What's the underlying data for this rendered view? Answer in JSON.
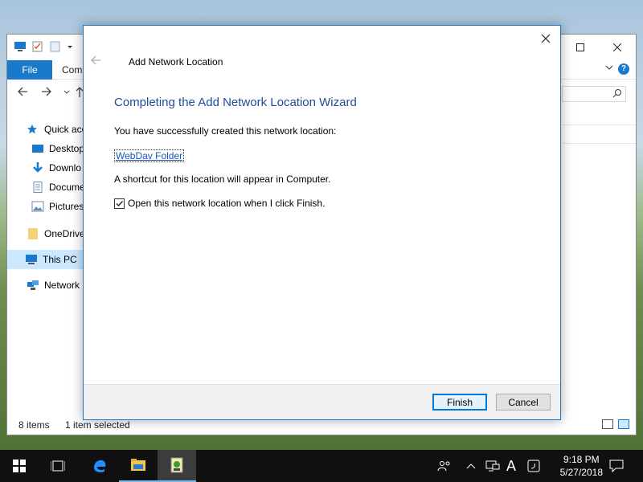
{
  "explorer": {
    "ribbon": {
      "file_tab": "File",
      "next_tab": "Comp"
    },
    "help_glyph": "?",
    "sidebar": [
      {
        "label": "Quick acc",
        "icon": "star-icon",
        "color": "#1979ca"
      },
      {
        "label": "Desktop",
        "icon": "desktop-icon",
        "color": "#1979ca"
      },
      {
        "label": "Downlo",
        "icon": "download-icon",
        "color": "#1979ca"
      },
      {
        "label": "Docume",
        "icon": "document-icon",
        "color": "#6b8bb5"
      },
      {
        "label": "Pictures",
        "icon": "pictures-icon",
        "color": "#6b8bb5"
      },
      {
        "label": "OneDrive",
        "icon": "folder-icon",
        "color": "#f3d27a"
      },
      {
        "label": "This PC",
        "icon": "computer-icon",
        "color": "#1979ca"
      },
      {
        "label": "Network",
        "icon": "network-icon",
        "color": "#1979ca"
      }
    ],
    "status": {
      "item_count": "8 items",
      "selection": "1 item selected"
    }
  },
  "dialog": {
    "title": "Add Network Location",
    "heading": "Completing the Add Network Location Wizard",
    "success_text": "You have successfully created this network location:",
    "location_link": "WebDav Folder",
    "shortcut_text": "A shortcut for this location will appear in Computer.",
    "open_checkbox_label": "Open this network location when I click Finish.",
    "open_checkbox_checked": true,
    "finish_button": "Finish",
    "cancel_button": "Cancel"
  },
  "taskbar": {
    "ime_indicator": "A",
    "time": "9:18 PM",
    "date": "5/27/2018"
  }
}
